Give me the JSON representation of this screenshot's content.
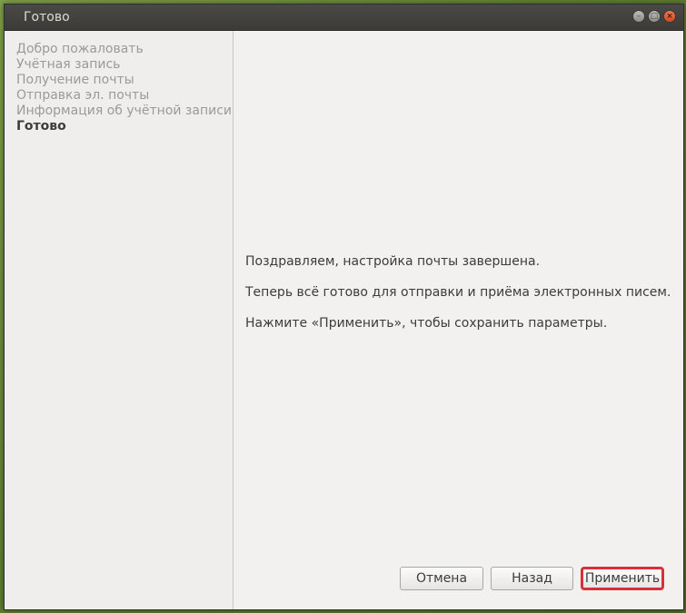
{
  "window": {
    "title": "Готово"
  },
  "sidebar": {
    "items": [
      {
        "label": "Добро пожаловать"
      },
      {
        "label": "Учётная запись"
      },
      {
        "label": "Получение почты"
      },
      {
        "label": "Отправка эл. почты"
      },
      {
        "label": "Информация об учётной записи"
      },
      {
        "label": "Готово"
      }
    ],
    "active_index": 5
  },
  "content": {
    "line1": "Поздравляем, настройка почты завершена.",
    "line2": "Теперь всё готово для отправки и приёма электронных писем.",
    "line3": "Нажмите «Применить», чтобы сохранить параметры."
  },
  "buttons": {
    "cancel": "Отмена",
    "back": "Назад",
    "apply": "Применить"
  },
  "colors": {
    "titlebar": "#3c3b37",
    "close_button": "#d9461b",
    "highlight_border": "#d8303a"
  }
}
